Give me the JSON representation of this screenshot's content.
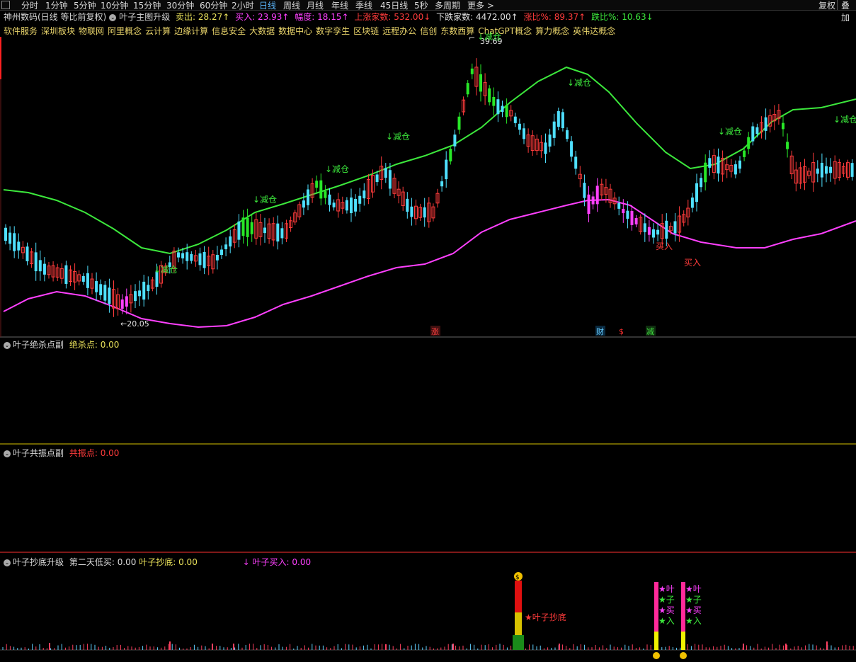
{
  "periods": [
    "分时",
    "1分钟",
    "5分钟",
    "10分钟",
    "15分钟",
    "30分钟",
    "60分钟",
    "2小时",
    "日线",
    "周线",
    "月线",
    "年线",
    "季线",
    "45日线",
    "5秒",
    "多周期",
    "更多 >"
  ],
  "active_period": "日线",
  "right_buttons": [
    "复权",
    "叠加"
  ],
  "info_line": {
    "stock": "神州数码(日线 等比前复权)",
    "indicator": "叶子主图升级",
    "sell": "卖出: 28.27↑",
    "buy": "买入: 23.93↑",
    "amplitude": "幅度: 18.15↑",
    "up_count": "上涨家数: 532.00↓",
    "down_count": "下跌家数: 4472.00↑",
    "up_ratio": "涨比%: 89.37↑",
    "down_ratio": "跌比%: 10.63↓"
  },
  "concepts": [
    "软件服务",
    "深圳板块",
    "物联网",
    "阿里概念",
    "云计算",
    "边缘计算",
    "信息安全",
    "大数据",
    "数据中心",
    "数字孪生",
    "区块链",
    "远程办公",
    "信创",
    "东数西算",
    "ChatGPT概念",
    "算力概念",
    "英伟达概念"
  ],
  "main_chart": {
    "high_label": "39.69",
    "low_label": "←20.05",
    "reduce_label": "↓减仓",
    "buy_label": "买入",
    "markers": [
      {
        "text": "涨",
        "color": "#ff4040",
        "bg": "#401010"
      },
      {
        "text": "财",
        "color": "#66ccff",
        "bg": "#0a2a40"
      },
      {
        "text": "$",
        "color": "#ff3030",
        "bg": "#000"
      },
      {
        "text": "减",
        "color": "#40e040",
        "bg": "#103010"
      }
    ]
  },
  "panel1": {
    "name": "叶子绝杀点副",
    "field": "绝杀点: 0.00"
  },
  "panel2": {
    "name": "叶子共振点副",
    "field": "共振点: 0.00"
  },
  "panel3": {
    "name": "叶子抄底升级",
    "second_low": "第二天低买: 0.00",
    "bottom": "叶子抄底: 0.00",
    "buy_field": "↓ 叶子买入: 0.00",
    "bottom_signal": "★叶子抄底",
    "star_chars": [
      "★叶",
      "★子",
      "★买",
      "★入"
    ]
  },
  "colors": {
    "up": "#ff3b3b",
    "down": "#4fe0ff",
    "upper_band": "#3ce83c",
    "lower_band": "#ff40ff",
    "strong_up": "#28e828",
    "weak": "#ff40ff"
  }
}
